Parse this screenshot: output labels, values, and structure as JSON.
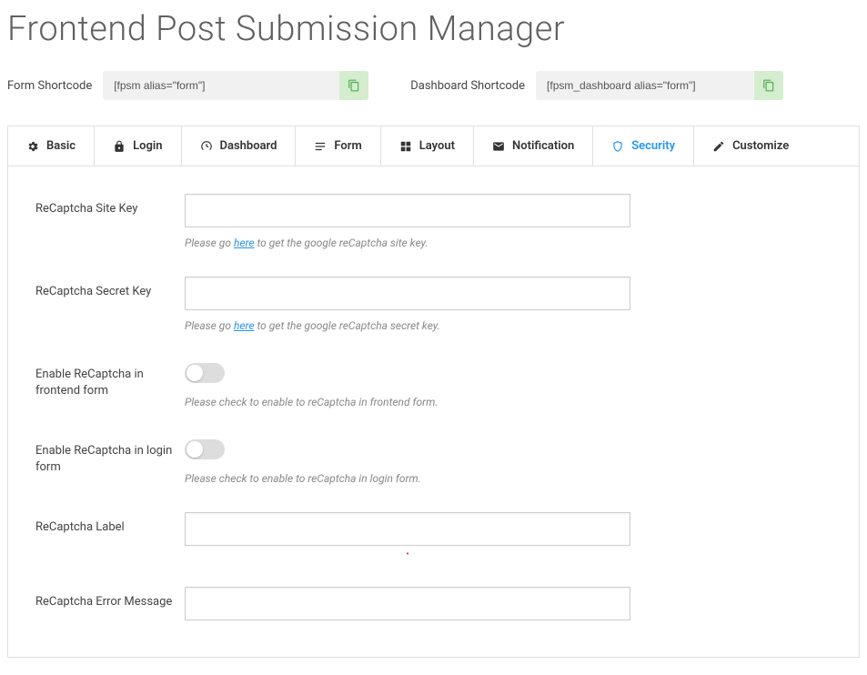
{
  "page_title": "Frontend Post Submission Manager",
  "shortcodes": {
    "form_label": "Form Shortcode",
    "form_value": "[fpsm alias=\"form\"]",
    "dash_label": "Dashboard Shortcode",
    "dash_value": "[fpsm_dashboard alias=\"form\"]"
  },
  "tabs": {
    "basic": "Basic",
    "login": "Login",
    "dashboard": "Dashboard",
    "form": "Form",
    "layout": "Layout",
    "notification": "Notification",
    "security": "Security",
    "customize": "Customize"
  },
  "fields": {
    "site_key": {
      "label": "ReCaptcha Site Key",
      "value": "",
      "hint_pre": "Please go ",
      "hint_link": "here",
      "hint_post": " to get the google reCaptcha site key."
    },
    "secret_key": {
      "label": "ReCaptcha Secret Key",
      "value": "",
      "hint_pre": "Please go ",
      "hint_link": "here",
      "hint_post": " to get the google reCaptcha secret key."
    },
    "enable_frontend": {
      "label": "Enable ReCaptcha in frontend form",
      "hint": "Please check to enable to reCaptcha in frontend form."
    },
    "enable_login": {
      "label": "Enable ReCaptcha in login form",
      "hint": "Please check to enable to reCaptcha in login form."
    },
    "recaptcha_label": {
      "label": "ReCaptcha Label",
      "value": ""
    },
    "error_message": {
      "label": "ReCaptcha Error Message",
      "value": ""
    }
  }
}
